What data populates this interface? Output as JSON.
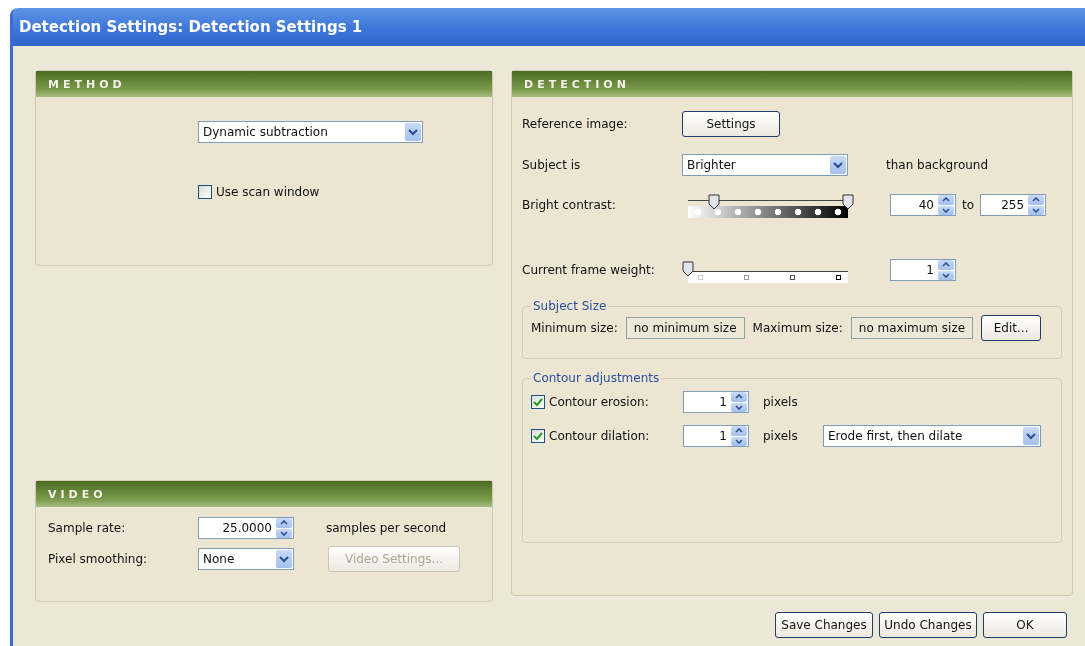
{
  "window": {
    "title": "Detection Settings: Detection Settings 1"
  },
  "method": {
    "title": "METHOD",
    "dropdown": {
      "value": "Dynamic subtraction"
    },
    "scan_window": {
      "label": "Use scan window",
      "checked": false
    }
  },
  "video": {
    "title": "VIDEO",
    "sample_rate": {
      "label": "Sample rate:",
      "value": "25.0000",
      "unit": "samples per second"
    },
    "pixel_smoothing": {
      "label": "Pixel smoothing:",
      "value": "None"
    },
    "video_settings": {
      "label": "Video Settings...",
      "disabled": true
    }
  },
  "detection": {
    "title": "DETECTION",
    "reference_image": {
      "label": "Reference image:",
      "button": "Settings"
    },
    "subject_is": {
      "label": "Subject is",
      "value": "Brighter",
      "suffix": "than background"
    },
    "bright_contrast": {
      "label": "Bright contrast:",
      "thumbs": [
        {
          "level": 0.16
        },
        {
          "level": 1
        }
      ],
      "from": "40",
      "to_label": "to",
      "to": "255"
    },
    "frame_weight": {
      "label": "Current frame weight:",
      "level": 0,
      "value": "1"
    },
    "subject_size": {
      "title": "Subject Size",
      "min_label": "Minimum size:",
      "min_value": "no minimum size",
      "max_label": "Maximum size:",
      "max_value": "no maximum size",
      "button": "Edit..."
    },
    "contour": {
      "title": "Contour adjustments",
      "rows": [
        {
          "label": "Contour erosion:",
          "checked": true,
          "value": "1",
          "unit": "pixels"
        },
        {
          "label": "Contour dilation:",
          "checked": true,
          "value": "1",
          "unit": "pixels",
          "order": "Erode first, then dilate"
        }
      ]
    }
  },
  "buttons": [
    "Save Changes",
    "Undo Changes",
    "OK"
  ]
}
